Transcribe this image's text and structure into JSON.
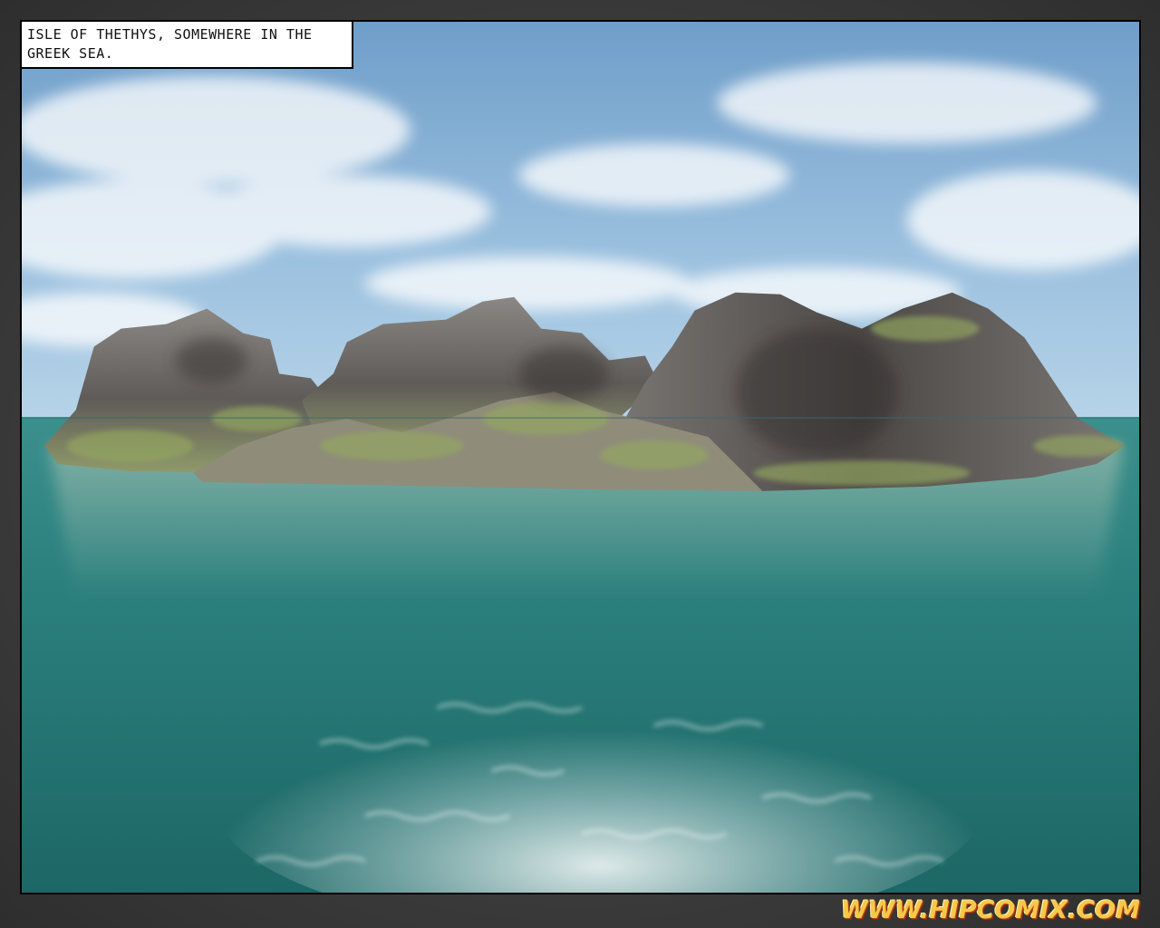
{
  "caption": {
    "text": "Isle of Thethys, somewhere in the Greek sea."
  },
  "watermark": {
    "text": "WWW.HIPCOMIX.COM"
  },
  "colors": {
    "sky_top": "#6f9ec9",
    "sky_bottom": "#b6d3e8",
    "sea_near": "#1f6f6e",
    "sea_far": "#3b8f8c",
    "rock": "#6e6a66",
    "moss": "#8aa05a",
    "watermark_fill": "#f6c84a"
  }
}
